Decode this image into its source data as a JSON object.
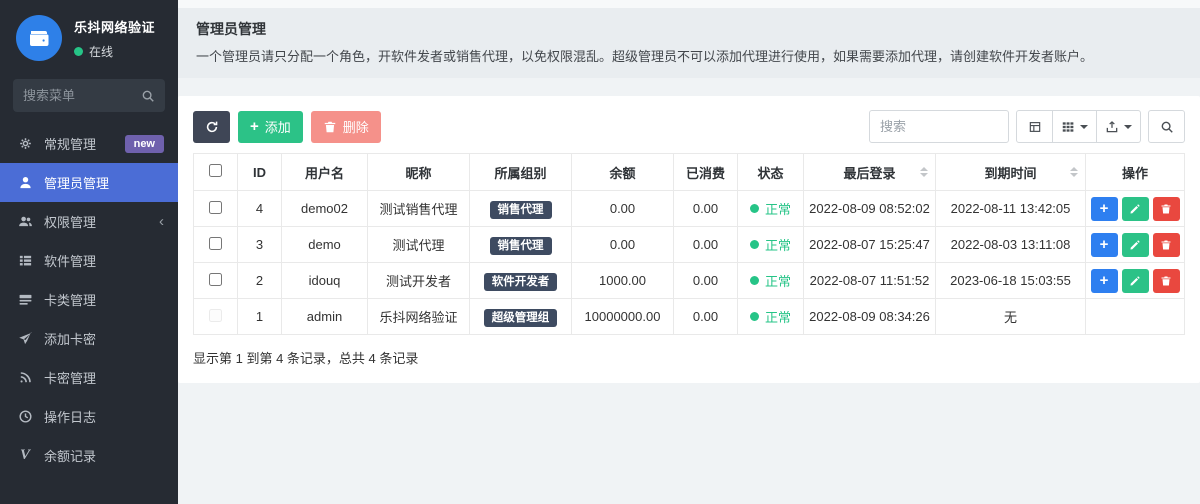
{
  "app": {
    "title": "乐抖网络验证",
    "status": "在线"
  },
  "colors": {
    "sidebar_bg": "#262b33",
    "active_blue": "#4b6dd6",
    "logo_blue": "#2e80e8",
    "badge_purple": "#6f61ad",
    "green": "#2cc287",
    "salmon_red": "#f5918a",
    "dark_navy_btn": "#3f4656",
    "group_badge_navy": "#3e4b61",
    "status_green": "#26c487",
    "action_blue": "#2e7ff0",
    "action_red": "#e9483f"
  },
  "sidebar": {
    "search_placeholder": "搜索菜单",
    "menu": [
      {
        "label": "常规管理",
        "icon": "gears-icon",
        "badge": "new"
      },
      {
        "label": "管理员管理",
        "icon": "user-icon",
        "active": true
      },
      {
        "label": "权限管理",
        "icon": "users-icon",
        "chevron": "collapsed"
      },
      {
        "label": "软件管理",
        "icon": "list-icon"
      },
      {
        "label": "卡类管理",
        "icon": "card-types-icon"
      },
      {
        "label": "添加卡密",
        "icon": "paper-plane-icon"
      },
      {
        "label": "卡密管理",
        "icon": "rss-icon"
      },
      {
        "label": "操作日志",
        "icon": "clock-icon"
      },
      {
        "label": "余额记录",
        "icon": "v-icon"
      }
    ]
  },
  "page": {
    "title": "管理员管理",
    "description": "一个管理员请只分配一个角色，开软件发者或销售代理，以免权限混乱。超级管理员不可以添加代理进行使用，如果需要添加代理，请创建软件开发者账户。"
  },
  "toolbar": {
    "add_label": "添加",
    "delete_label": "删除",
    "search_placeholder": "搜索",
    "icon_buttons": [
      "toggle-view-icon",
      "columns-grid-icon",
      "export-icon",
      "search-icon"
    ]
  },
  "table": {
    "headers": {
      "id": "ID",
      "username": "用户名",
      "nickname": "昵称",
      "group": "所属组别",
      "balance": "余额",
      "consumed": "已消费",
      "status": "状态",
      "last_login": "最后登录",
      "expire": "到期时间",
      "actions": "操作"
    },
    "rows": [
      {
        "id": "4",
        "username": "demo02",
        "nickname": "测试销售代理",
        "group": "销售代理",
        "balance": "0.00",
        "consumed": "0.00",
        "status": "正常",
        "last_login": "2022-08-09 08:52:02",
        "expire": "2022-08-11 13:42:05"
      },
      {
        "id": "3",
        "username": "demo",
        "nickname": "测试代理",
        "group": "销售代理",
        "balance": "0.00",
        "consumed": "0.00",
        "status": "正常",
        "last_login": "2022-08-07 15:25:47",
        "expire": "2022-08-03 13:11:08"
      },
      {
        "id": "2",
        "username": "idouq",
        "nickname": "测试开发者",
        "group": "软件开发者",
        "balance": "1000.00",
        "consumed": "0.00",
        "status": "正常",
        "last_login": "2022-08-07 11:51:52",
        "expire": "2023-06-18 15:03:55"
      },
      {
        "id": "1",
        "username": "admin",
        "nickname": "乐抖网络验证",
        "group": "超级管理组",
        "balance": "10000000.00",
        "consumed": "0.00",
        "status": "正常",
        "last_login": "2022-08-09 08:34:26",
        "expire": "无"
      }
    ],
    "footer": "显示第 1 到第 4 条记录，总共 4 条记录"
  }
}
